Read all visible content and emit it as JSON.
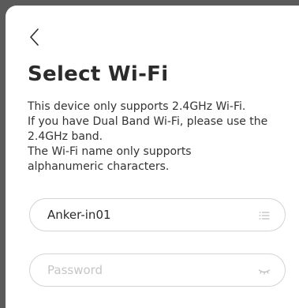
{
  "header": {
    "title": "Select Wi-Fi"
  },
  "description": {
    "lines": [
      "This device only supports 2.4GHz Wi-Fi.",
      "If you have Dual Band Wi-Fi, please use the",
      "2.4GHz band.",
      "The Wi-Fi name only supports",
      "alphanumeric characters."
    ]
  },
  "form": {
    "ssid": {
      "value": "Anker-in01",
      "icon": "list-icon"
    },
    "password": {
      "value": "",
      "placeholder": "Password",
      "icon": "eye-closed-icon"
    }
  },
  "icons": {
    "back": "chevron-left-icon"
  },
  "colors": {
    "text": "#2b2b2b",
    "border": "#d4d4d4",
    "placeholder": "#c6c6c6",
    "backdrop": "#5a5a5a"
  }
}
